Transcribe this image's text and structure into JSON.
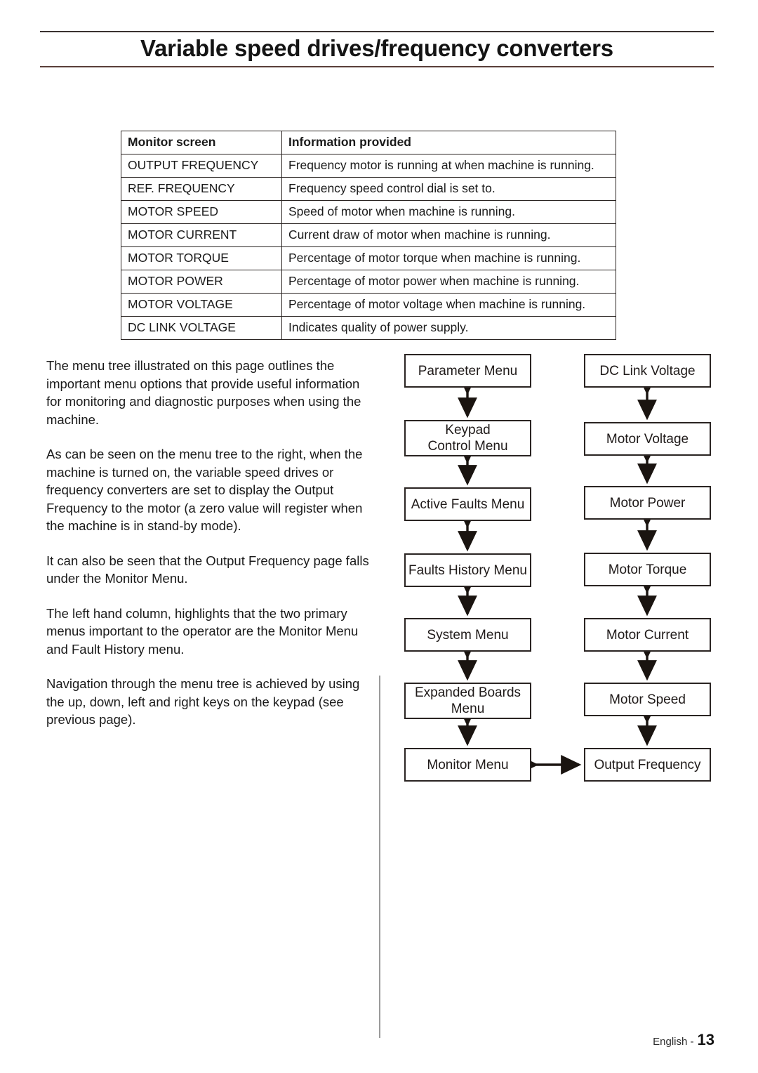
{
  "page": {
    "title": "Variable speed drives/frequency converters",
    "footer_language": "English -",
    "footer_page_number": "13"
  },
  "table": {
    "headers": [
      "Monitor screen",
      "Information provided"
    ],
    "rows": [
      [
        "OUTPUT FREQUENCY",
        "Frequency motor is running at when machine is running."
      ],
      [
        "REF. FREQUENCY",
        "Frequency speed control dial is set to."
      ],
      [
        "MOTOR SPEED",
        "Speed of motor when machine is running."
      ],
      [
        "MOTOR CURRENT",
        "Current draw of motor when machine is running."
      ],
      [
        "MOTOR TORQUE",
        "Percentage of motor torque when machine is running."
      ],
      [
        "MOTOR POWER",
        "Percentage of motor power when machine is running."
      ],
      [
        "MOTOR VOLTAGE",
        "Percentage of motor voltage when machine is running."
      ],
      [
        "DC LINK VOLTAGE",
        "Indicates quality of power supply."
      ]
    ]
  },
  "body": {
    "paragraphs": [
      "The menu tree illustrated on this page outlines the important menu options that provide useful information for monitoring and diagnostic purposes when using the machine.",
      "As can be seen on the menu tree to the right, when the machine is turned on, the variable speed drives or frequency converters are set to display the Output Frequency to the motor (a zero value will register when the machine is in stand-by mode).",
      "It can also be seen that the Output Frequency page falls under the Monitor Menu.",
      "The left hand column, highlights that the two primary menus important to the operator are the Monitor Menu and Fault History menu.",
      "Navigation through the menu tree is achieved by using the up, down, left and right keys on the keypad (see previous page)."
    ]
  },
  "menu_tree": {
    "left_column": [
      "Parameter Menu",
      "Keypad\nControl Menu",
      "Active Faults Menu",
      "Faults History Menu",
      "System Menu",
      "Expanded Boards\nMenu",
      "Monitor Menu"
    ],
    "right_column": [
      "DC Link Voltage",
      "Motor Voltage",
      "Motor Power",
      "Motor Torque",
      "Motor Current",
      "Motor Speed",
      "Output Frequency"
    ],
    "connector_type": "double-headed-arrow",
    "cross_link": {
      "from": "Monitor Menu",
      "to": "Output Frequency",
      "type": "double-headed-arrow"
    }
  },
  "colors": {
    "ink": "#1a1a1a",
    "rule": "#3a3230",
    "box_border": "#2a2422",
    "divider": "#9a9a9a"
  }
}
